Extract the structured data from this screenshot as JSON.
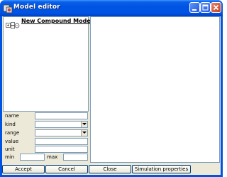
{
  "window": {
    "title": "Model editor",
    "controls": [
      "minimize-icon",
      "maximize-icon",
      "close-icon"
    ]
  },
  "tree": {
    "root_label": "New Compound Model",
    "root_icon": "compound-model-icon"
  },
  "properties": {
    "name_label": "name",
    "name_value": "",
    "kind_label": "kind",
    "kind_value": "",
    "range_label": "range",
    "range_value": "",
    "value_label": "value",
    "value_value": "",
    "unit_label": "unit",
    "unit_value": "",
    "min_label": "min",
    "min_value": "",
    "max_label": "max",
    "max_value": ""
  },
  "buttons": {
    "accept": "Accept",
    "cancel": "Cancel",
    "close": "Close",
    "simulation_properties": "Simulation properties"
  }
}
